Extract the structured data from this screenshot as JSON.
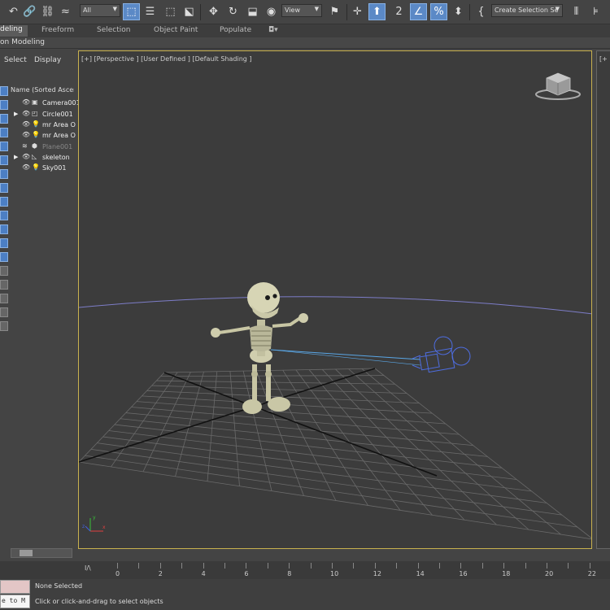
{
  "toolbar": {
    "selection_filter": "All",
    "ref_coord": "View",
    "named_selection_placeholder": "Create Selection Se",
    "icons": [
      "undo-link-icon",
      "unlink-icon",
      "bind-spacewarp-icon",
      "select-object-icon",
      "select-by-name-icon",
      "rect-region-icon",
      "window-crossing-icon",
      "move-icon",
      "rotate-icon",
      "scale-icon",
      "place-icon",
      "pivot-icon",
      "select-manipulate-icon",
      "keyboard-shortcut-icon",
      "snap-icon",
      "angle-snap-icon",
      "percent-snap-icon",
      "spinner-snap-icon",
      "edit-named-selection-icon",
      "mirror-icon",
      "align-icon"
    ],
    "active_color": "#5b89c6"
  },
  "ribbon": {
    "tabs": [
      "deling",
      "Freeform",
      "Selection",
      "Object Paint",
      "Populate"
    ],
    "active_tab": "deling",
    "sub_label": "on Modeling",
    "extra_glyph": "◘▾"
  },
  "explorer": {
    "menu": [
      "Select",
      "Display"
    ],
    "column_header": "Name (Sorted Ascend",
    "rows": [
      {
        "name": "Camera001",
        "expand": "",
        "eye": "👁",
        "type": "▣",
        "dim": false
      },
      {
        "name": "Circle001",
        "expand": "▶",
        "eye": "👁",
        "type": "◰",
        "dim": false
      },
      {
        "name": "mr Area O",
        "expand": "",
        "eye": "👁",
        "type": "💡",
        "dim": false
      },
      {
        "name": "mr Area O",
        "expand": "",
        "eye": "👁",
        "type": "💡",
        "dim": false
      },
      {
        "name": "Plane001",
        "expand": "",
        "eye": "≋",
        "type": "⬢",
        "dim": true
      },
      {
        "name": "skeleton",
        "expand": "▶",
        "eye": "👁",
        "type": "◺",
        "dim": false
      },
      {
        "name": "Sky001",
        "expand": "",
        "eye": "👁",
        "type": "💡",
        "dim": false
      }
    ]
  },
  "viewport": {
    "label": "[+] [Perspective ] [User Defined ] [Default Shading ]",
    "border_color": "#c9b24f",
    "background": "#3c3c3c",
    "right_label": "[+"
  },
  "timeline": {
    "toggle": "I/\\",
    "frames": [
      "0",
      "2",
      "4",
      "6",
      "8",
      "10",
      "12",
      "14",
      "16",
      "18",
      "20",
      "22"
    ]
  },
  "status": {
    "maxscript_text": "e to M",
    "selection": "None Selected",
    "prompt": "Click or click-and-drag to select objects"
  }
}
